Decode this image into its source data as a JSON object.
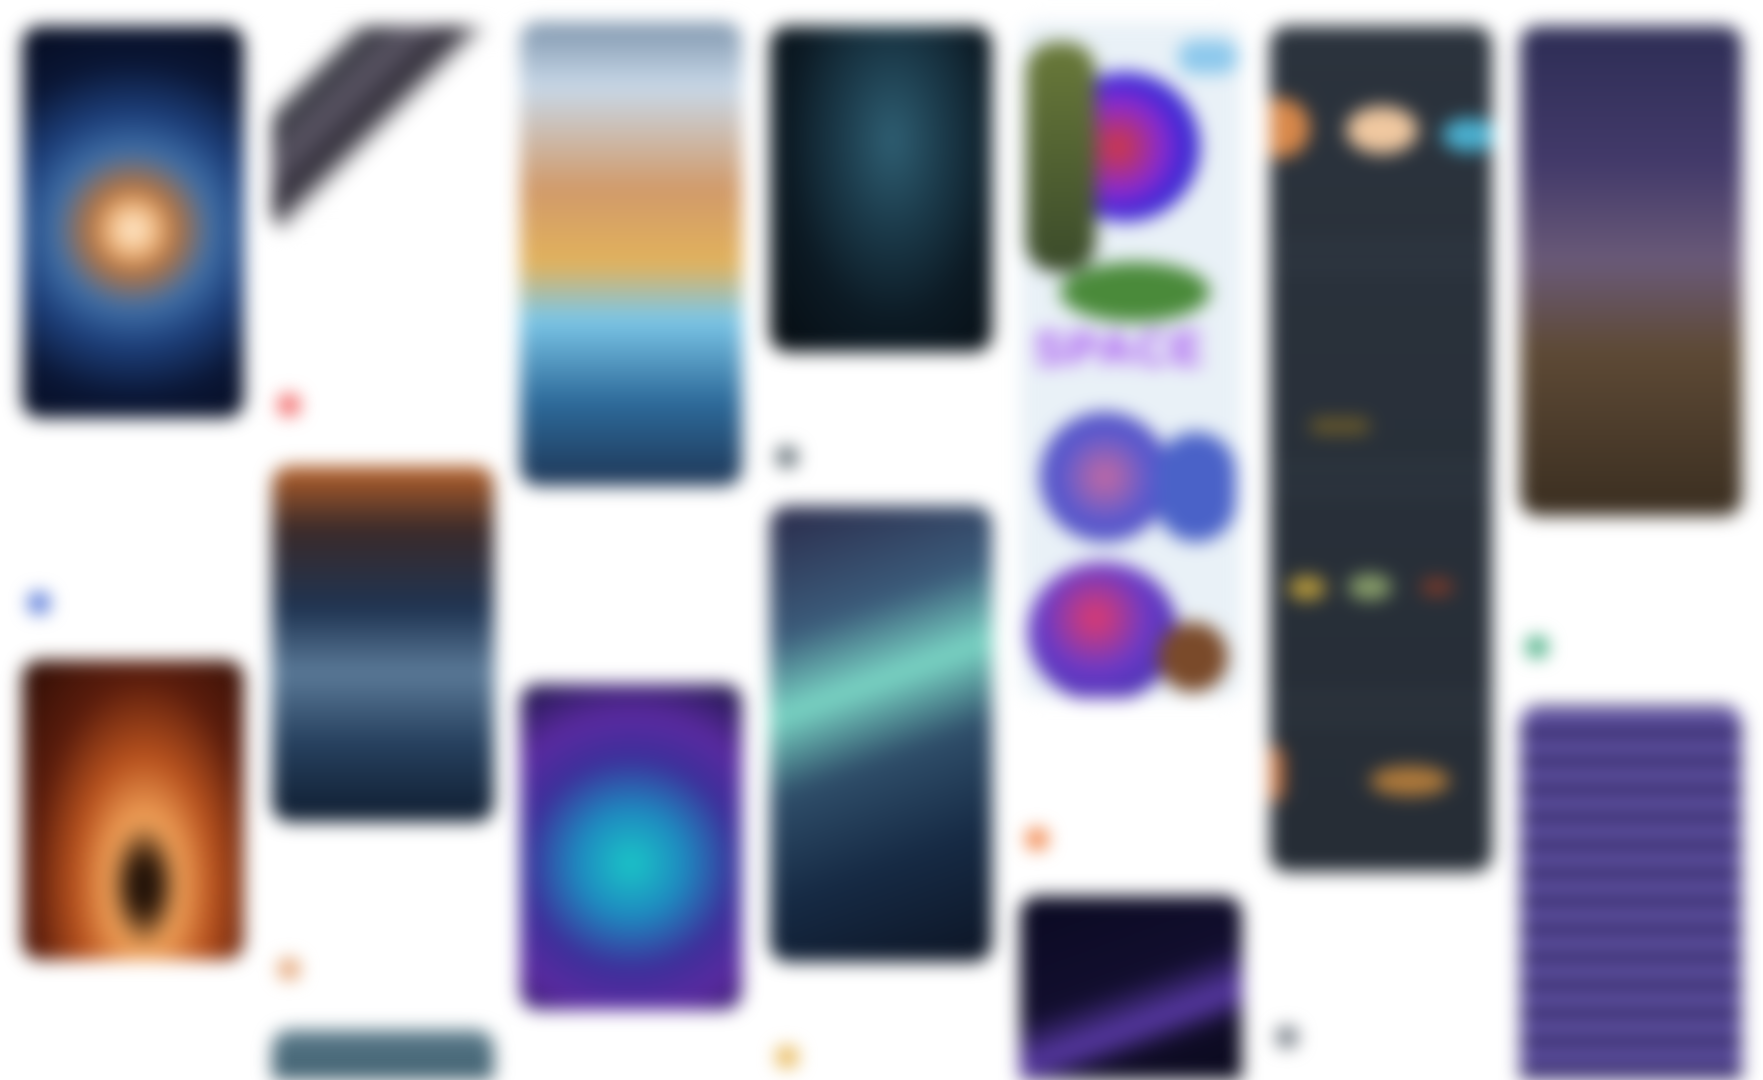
{
  "feed": {
    "pins": [
      {
        "id": "galaxy-spiral",
        "bg": "radial-gradient(circle at 50% 52%, #fff0d8 0, #f5c08a 9%, #b5733f 18%, #3f6ea6 34%, #1d3f7a 50%, #0a1635 72%, #050b1f 100%)",
        "title": "",
        "subtitle": "",
        "author": "",
        "avatar_color": "#4b6fd6"
      },
      {
        "id": "space-shuttle",
        "bg": "linear-gradient(135deg, #ffffff 0, #ffffff 18%, #3a3a44 24%, #5a5564 34%, #2e2b36 44%, #ffffff 52%, #ffffff 100%)",
        "title": "",
        "subtitle": "",
        "author": "",
        "avatar_color": "#f15a5a"
      },
      {
        "id": "earth-viewport",
        "bg": "linear-gradient(180deg, #7e95ad 0, #c8d8e8 14%, #d19a6a 36%, #e2b25c 52%, #7cc7e8 64%, #2d6a9a 82%, #1e3656 100%)",
        "title": "",
        "subtitle": "",
        "author": "",
        "avatar_color": "#7a7a84"
      },
      {
        "id": "astronaut-dark",
        "bg": "radial-gradient(ellipse at 55% 35%, #2f5f73 0, #1b3a4a 30%, #0c1a24 60%, #050b10 100%)",
        "title": "",
        "subtitle": "",
        "author": "",
        "avatar_color": "#5d6a72"
      },
      {
        "id": "space-stickers",
        "bg": "linear-gradient(180deg, #e9f1f7 0, #e9f1f7 100%)",
        "title": "",
        "subtitle": "",
        "author": "",
        "avatar_color": "#f07a3a",
        "sticker_text": "SPACE"
      },
      {
        "id": "planets-ui",
        "bg": "linear-gradient(180deg, #2b333d 0, #262d36 100%)",
        "title": "",
        "subtitle": "",
        "author": "",
        "avatar_color": "#6e7680"
      },
      {
        "id": "rocket-launch",
        "bg": "linear-gradient(180deg, #2d2d55 0, #433a6a 28%, #6a5a78 48%, #5e4a36 66%, #3a2e20 100%)",
        "title": "",
        "subtitle": "",
        "author": "",
        "avatar_color": "#3aa87a"
      },
      {
        "id": "black-hole",
        "bg": "radial-gradient(ellipse at 55% 75%, #1a0f0a 0, #2a1608 8%, #f2a35a 20%, #b8521e 40%, #5a1c0c 65%, #2a0c05 100%)",
        "title": "",
        "subtitle": "",
        "author": "",
        "avatar_color": "#9a9aa2"
      },
      {
        "id": "mars-astronauts",
        "bg": "linear-gradient(180deg, #b8622a 0, #3a2a2a 18%, #1f3452 40%, #5b7a98 58%, #26405e 78%, #0f1d30 100%)",
        "title": "",
        "subtitle": "",
        "author": "",
        "avatar_color": "#e3a070"
      },
      {
        "id": "cosmic-triangle",
        "bg": "radial-gradient(circle at 50% 55%, #1ac7c7 0, #1e8ac0 25%, #3d2f9a 50%, #5a2aa0 70%, #1a1640 100%)",
        "title": "",
        "subtitle": "",
        "author": "",
        "avatar_color": "#9a9aa2"
      },
      {
        "id": "aurora-planet",
        "bg": "linear-gradient(160deg, #2a2a4a 0, #3b5b7a 25%, #7ad6c5 40%, #2f4e6a 55%, #162a44 75%, #0c1424 100%)",
        "title": "",
        "subtitle": "",
        "author": "",
        "avatar_color": "#e6b24a"
      },
      {
        "id": "meteor-streak",
        "bg": "linear-gradient(160deg, #0a0a22 0, #120e2e 45%, #5a3aa8 62%, #0f0c26 72%, #08081a 100%)",
        "title": "",
        "subtitle": "",
        "author": "",
        "avatar_color": "#9a9aa2"
      },
      {
        "id": "planets-list",
        "bg": "linear-gradient(180deg, #2b333d 0, #262d36 100%)",
        "title": "",
        "subtitle": "",
        "author": "",
        "avatar_color": "#6e7680"
      },
      {
        "id": "purple-wormhole",
        "bg": "repeating-linear-gradient(180deg, #2a1f5a 0, #7a6ac8 14px, #1c1540 28px), linear-gradient(180deg, #2a1f5a, #1c1540)",
        "title": "",
        "subtitle": "",
        "author": "",
        "avatar_color": "#9a9aa2"
      },
      {
        "id": "earth-bottom",
        "bg": "linear-gradient(180deg, #5a7a8a 0, #3a5a6a 100%)",
        "title": "",
        "subtitle": "",
        "author": "",
        "avatar_color": "#9a9aa2"
      }
    ]
  },
  "colors": {
    "page_bg": "#ffffff",
    "text_muted": "#c7c7cc"
  }
}
